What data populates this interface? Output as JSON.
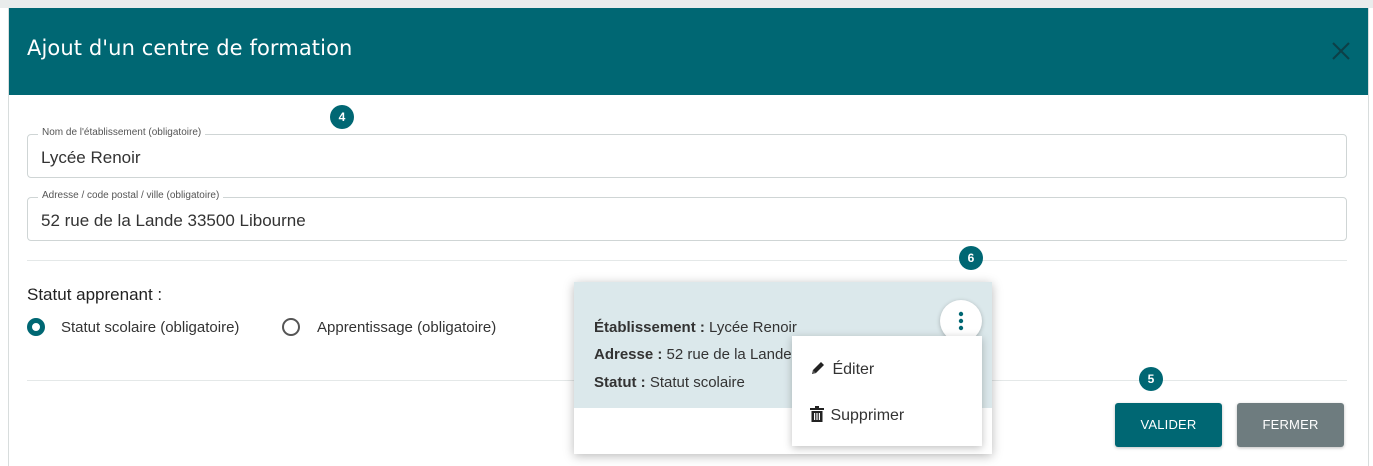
{
  "modal": {
    "title": "Ajout d'un centre de formation"
  },
  "form": {
    "name_label": "Nom de l'établissement (obligatoire)",
    "name_value": "Lycée Renoir",
    "address_label": "Adresse / code postal / ville (obligatoire)",
    "address_value": "52 rue de la Lande 33500 Libourne",
    "status_heading": "Statut apprenant :",
    "status_options": [
      {
        "label": "Statut scolaire (obligatoire)",
        "checked": true
      },
      {
        "label": "Apprentissage (obligatoire)",
        "checked": false
      }
    ]
  },
  "badges": [
    "4",
    "5",
    "6"
  ],
  "card": {
    "establishment_key": "Établissement :",
    "establishment_value": "Lycée Renoir",
    "address_key": "Adresse :",
    "address_value": "52 rue de la Lande",
    "status_key": "Statut :",
    "status_value": "Statut scolaire"
  },
  "menu": {
    "edit_label": "Éditer",
    "delete_label": "Supprimer"
  },
  "actions": {
    "validate_label": "VALIDER",
    "close_label": "FERMER"
  },
  "colors": {
    "primary": "#006773",
    "secondary_button": "#6e7c7f",
    "card_background": "#dbe8eb"
  },
  "icons": [
    "close-icon",
    "kebab-menu-icon",
    "pencil-icon",
    "trash-icon"
  ]
}
